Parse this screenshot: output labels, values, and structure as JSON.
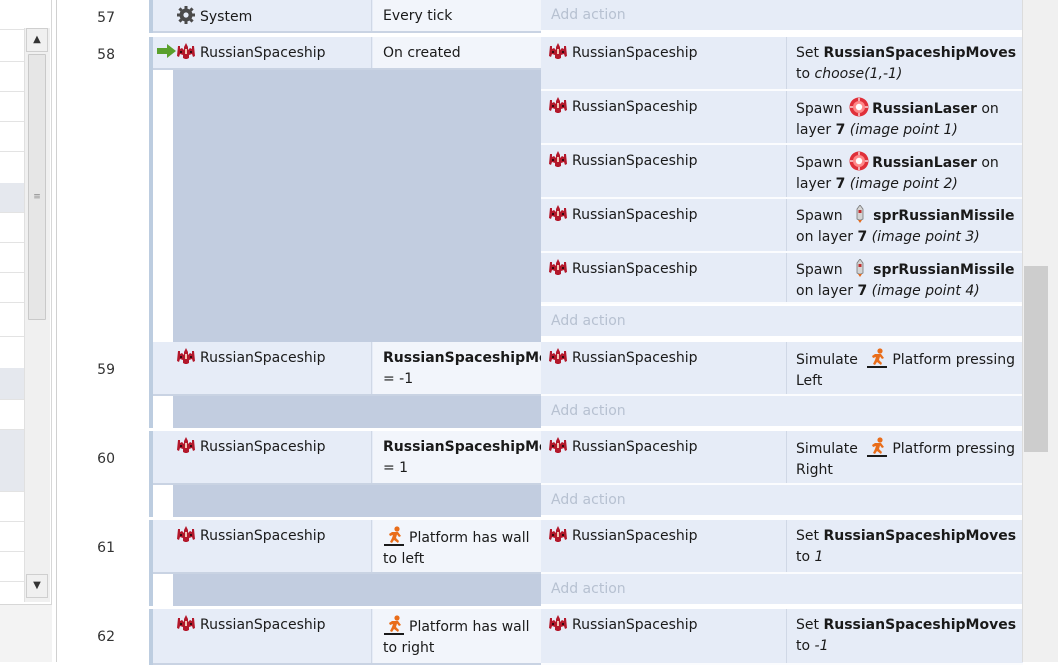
{
  "left_pane": {
    "scroll_up_glyph": "▲",
    "scroll_down_glyph": "▼",
    "grip_glyph": "≡"
  },
  "events": [
    {
      "line": "57",
      "condition": {
        "object": "System",
        "icon": "gear-icon",
        "text": "Every tick"
      },
      "actions": [],
      "add_action": "Add action"
    },
    {
      "line": "58",
      "trigger": true,
      "condition": {
        "object": "RussianSpaceship",
        "icon": "ship-icon",
        "text": "On created"
      },
      "actions": [
        {
          "object": "RussianSpaceship",
          "pre": "Set ",
          "bold": "RussianSpaceshipMoves",
          "post": " to ",
          "italic": "choose(1,-1)"
        },
        {
          "object": "RussianSpaceship",
          "pre": "Spawn ",
          "icon": "laser-icon",
          "bold": "RussianLaser",
          "post": " on layer ",
          "bold2": "7",
          "italic": "(image point 1)"
        },
        {
          "object": "RussianSpaceship",
          "pre": "Spawn ",
          "icon": "laser-icon",
          "bold": "RussianLaser",
          "post": " on layer ",
          "bold2": "7",
          "italic": "(image point 2)"
        },
        {
          "object": "RussianSpaceship",
          "pre": "Spawn ",
          "icon": "missile-icon",
          "bold": "sprRussianMissile",
          "post": " on layer ",
          "bold2": "7",
          "italic": "(image point 3)"
        },
        {
          "object": "RussianSpaceship",
          "pre": "Spawn ",
          "icon": "missile-icon",
          "bold": "sprRussianMissile",
          "post": " on layer ",
          "bold2": "7",
          "italic": "(image point 4)"
        }
      ],
      "add_action": "Add action"
    },
    {
      "line": "59",
      "condition": {
        "object": "RussianSpaceship",
        "icon": "ship-icon",
        "bold": "RussianSpaceshipMo",
        "text": " = -1"
      },
      "actions": [
        {
          "object": "RussianSpaceship",
          "pre": "Simulate ",
          "icon": "platform-icon",
          "post": "Platform pressing Left"
        }
      ],
      "add_action": "Add action"
    },
    {
      "line": "60",
      "condition": {
        "object": "RussianSpaceship",
        "icon": "ship-icon",
        "bold": "RussianSpaceshipMo",
        "text": " = 1"
      },
      "actions": [
        {
          "object": "RussianSpaceship",
          "pre": "Simulate ",
          "icon": "platform-icon",
          "post": "Platform pressing Right"
        }
      ],
      "add_action": "Add action"
    },
    {
      "line": "61",
      "condition": {
        "object": "RussianSpaceship",
        "icon": "ship-icon",
        "behavior_icon": "platform-icon",
        "text": "Platform has wall to left"
      },
      "actions": [
        {
          "object": "RussianSpaceship",
          "pre": "Set ",
          "bold": "RussianSpaceshipMoves",
          "post": " to ",
          "italic": "1"
        }
      ],
      "add_action": "Add action"
    },
    {
      "line": "62",
      "condition": {
        "object": "RussianSpaceship",
        "icon": "ship-icon",
        "behavior_icon": "platform-icon",
        "text": "Platform has wall to right"
      },
      "actions": [
        {
          "object": "RussianSpaceship",
          "pre": "Set ",
          "bold": "RussianSpaceshipMoves",
          "post": " to ",
          "italic": "-1"
        }
      ]
    }
  ],
  "colors": {
    "condition_bg": "#e6ecf7",
    "blank_area": "#c2cde0",
    "add_action_text": "#b7c1d1",
    "trigger_arrow": "#5aa02c",
    "ship_red": "#b3182b"
  }
}
